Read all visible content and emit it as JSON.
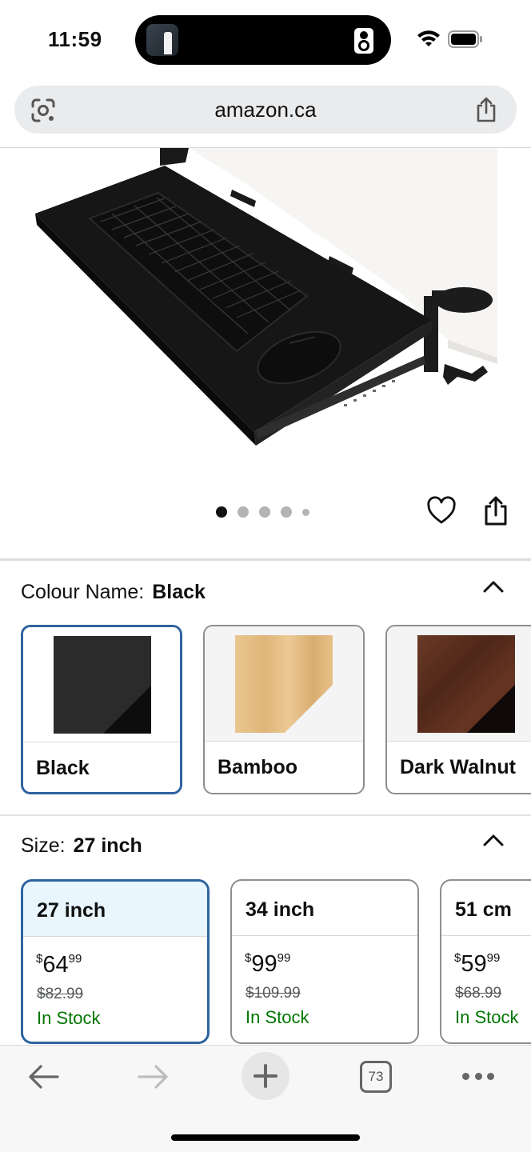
{
  "status_bar": {
    "time": "11:59"
  },
  "browser": {
    "url": "amazon.ca"
  },
  "gallery": {
    "image_count": 5,
    "active_index": 0
  },
  "colour": {
    "label": "Colour Name:",
    "selected": "Black",
    "options": [
      {
        "label": "Black",
        "swatch": "#2a2a2a",
        "selected": true
      },
      {
        "label": "Bamboo",
        "swatch": "#e8c58c",
        "selected": false
      },
      {
        "label": "Dark Walnut",
        "swatch": "#5c2e1f",
        "selected": false
      }
    ]
  },
  "size": {
    "label": "Size:",
    "selected": "27 inch",
    "options": [
      {
        "label": "27 inch",
        "price_whole": "64",
        "price_frac": "99",
        "was_price": "$82.99",
        "stock": "In Stock",
        "selected": true
      },
      {
        "label": "34 inch",
        "price_whole": "99",
        "price_frac": "99",
        "was_price": "$109.99",
        "stock": "In Stock",
        "selected": false
      },
      {
        "label": "51 cm",
        "price_whole": "59",
        "price_frac": "99",
        "was_price": "$68.99",
        "stock": "In Stock",
        "selected": false
      }
    ]
  },
  "toolbar": {
    "tab_count": "73"
  },
  "colors": {
    "accent_border": "#2f63a0",
    "in_stock": "#007600",
    "selected_bg": "#e9f6fd"
  }
}
